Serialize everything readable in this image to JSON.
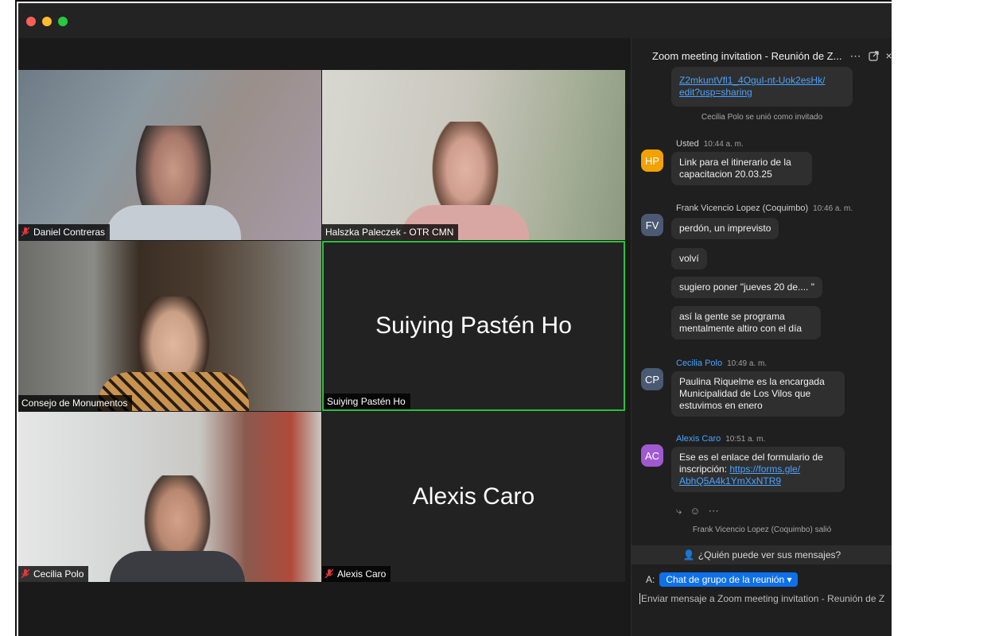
{
  "window": {
    "traffic_lights": [
      "#fe5f57",
      "#febc2e",
      "#28c840"
    ]
  },
  "participants": [
    {
      "name": "Daniel Contreras",
      "muted": true,
      "video": true
    },
    {
      "name": "Halszka Paleczek - OTR CMN",
      "muted": false,
      "video": true
    },
    {
      "name": "Consejo de Monumentos",
      "muted": false,
      "video": true
    },
    {
      "name": "Suiying Pastén Ho",
      "muted": false,
      "video": false,
      "big_label": "Suiying Pastén Ho",
      "active_speaker": true
    },
    {
      "name": "Cecilia Polo",
      "muted": true,
      "video": true
    },
    {
      "name": "Alexis Caro",
      "muted": true,
      "video": false,
      "big_label": "Alexis Caro"
    }
  ],
  "chat": {
    "title": "Zoom meeting invitation - Reunión de Z...",
    "top_link": [
      "Z2mkuntVfl1_4OguI-nt-Uok2esHk/",
      "edit?usp=sharing"
    ],
    "system_joined": "Cecilia Polo se unió como invitado",
    "messages": [
      {
        "initials": "HP",
        "color": "#f2a200",
        "sender": "Usted",
        "time": "10:44 a. m.",
        "bubbles": [
          [
            "Link para el itinerario de la",
            "capacitacion 20.03.25"
          ]
        ]
      },
      {
        "initials": "FV",
        "color": "#4a5a72",
        "sender": "Frank Vicencio Lopez (Coquimbo)",
        "time": "10:46 a. m.",
        "bubbles": [
          [
            "perdón, un imprevisto"
          ],
          [
            "volví"
          ],
          [
            "sugiero poner \"jueves 20 de.... \""
          ],
          [
            "así la gente se programa",
            "mentalmente altiro con el día"
          ]
        ]
      },
      {
        "initials": "CP",
        "color": "#4a5a72",
        "sender": "Cecilia Polo",
        "time": "10:49 a. m.",
        "bubbles": [
          [
            "Paulina Riquelme es la encargada",
            "Municipalidad de Los Vilos que",
            "estuvimos en enero"
          ]
        ]
      },
      {
        "initials": "AC",
        "color": "#a05ad0",
        "sender": "Alexis Caro",
        "time": "10:51 a. m.",
        "bubbles": [
          [
            "Ese es el enlace del formulario de",
            "inscripción: "
          ]
        ],
        "link": [
          "https://forms.gle/",
          "AbhQ5A4k1YmXxNTR9"
        ]
      }
    ],
    "system_left": "Frank Vicencio Lopez (Coquimbo) salió",
    "who_can_see": "¿Quién puede ver sus mensajes?",
    "to_label": "A:",
    "recipient": "Chat de grupo de la reunión",
    "input_placeholder": "Enviar mensaje a Zoom meeting invitation - Reunión de Z"
  }
}
